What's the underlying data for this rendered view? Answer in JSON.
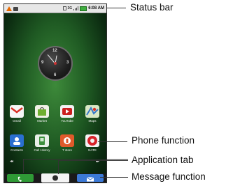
{
  "status_bar": {
    "network": "3G",
    "time": "6:08 AM"
  },
  "home_screen": {
    "clock_numbers": [
      "12",
      "3",
      "6",
      "9"
    ],
    "apps_row1": [
      {
        "label": "Gmail",
        "icon": "gmail-icon",
        "color": "#d93025"
      },
      {
        "label": "Market",
        "icon": "market-icon",
        "color": "#6fae2f"
      },
      {
        "label": "YouTube",
        "icon": "youtube-icon",
        "color": "#cc1f1f"
      },
      {
        "label": "Maps",
        "icon": "maps-icon",
        "color": "#7bb85b"
      }
    ],
    "apps_row2": [
      {
        "label": "Contacts",
        "icon": "contacts-icon",
        "color": "#2a6fd0"
      },
      {
        "label": "Call History",
        "icon": "call-history-icon",
        "color": "#3d8f3d"
      },
      {
        "label": "T store",
        "icon": "tstore-icon",
        "color": "#e05a2a"
      },
      {
        "label": "NATE",
        "icon": "nate-icon",
        "color": "#d8232a"
      }
    ]
  },
  "callouts": {
    "status_bar": "Status bar",
    "phone_function": "Phone function",
    "application_tab": "Application tab",
    "message_function": "Message function"
  }
}
